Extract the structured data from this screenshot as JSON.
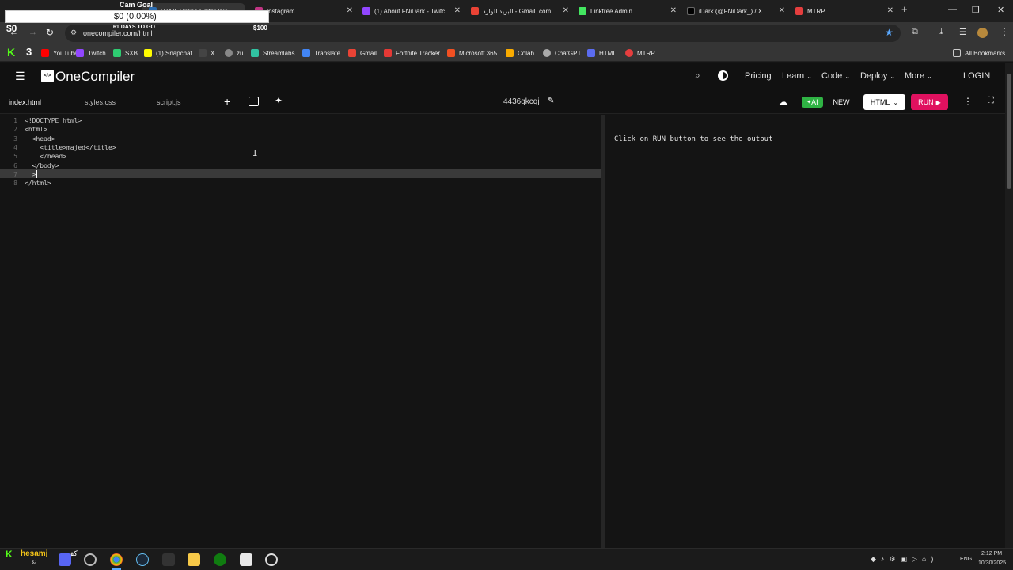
{
  "browser": {
    "tabs": [
      {
        "title": "HTML Online Editor (Co",
        "color": "#2b6cb0",
        "active": true
      },
      {
        "title": "Instagram",
        "color": "#c13584"
      },
      {
        "title": "(1) About FNiDark - Twitc",
        "color": "#9146ff"
      },
      {
        "title": "البريد الوارد - Gmail .com",
        "color": "#ea4335"
      },
      {
        "title": "Linktree Admin",
        "color": "#43e660"
      },
      {
        "title": "iDark (@FNiDark_) / X",
        "color": "#000000"
      },
      {
        "title": "MTRP",
        "color": "#e53e3e"
      }
    ],
    "new_tab": "+",
    "window_controls": {
      "minimize": "—",
      "restore": "❐",
      "close": "✕"
    },
    "url": "onecompiler.com/html",
    "bookmarks": [
      {
        "label": "YouTube",
        "color": "#ff0000"
      },
      {
        "label": "Twitch",
        "color": "#9146ff"
      },
      {
        "label": "SXB",
        "color": "#2ecc71"
      },
      {
        "label": "(1) Snapchat",
        "color": "#fffc00"
      },
      {
        "label": "X",
        "color": "#444444"
      },
      {
        "label": "zu",
        "color": "#888888"
      },
      {
        "label": "Streamlabs",
        "color": "#31c3a2"
      },
      {
        "label": "Translate",
        "color": "#4285f4"
      },
      {
        "label": "Gmail",
        "color": "#ea4335"
      },
      {
        "label": "Fortnite Tracker",
        "color": "#e53935"
      },
      {
        "label": "Microsoft 365",
        "color": "#f25022"
      },
      {
        "label": "Colab",
        "color": "#f9ab00"
      },
      {
        "label": "ChatGPT",
        "color": "#aaaaaa"
      },
      {
        "label": "HTML",
        "color": "#5b6cf0"
      },
      {
        "label": "MTRP",
        "color": "#e53e3e"
      }
    ],
    "all_bookmarks": "All Bookmarks"
  },
  "promo": {
    "title": "Cam Goal",
    "amount": "$0 (0.00%)",
    "current": "$0",
    "days": "61 DAYS TO GO",
    "goal": "$100"
  },
  "app": {
    "logo_text": "OneCompiler",
    "logo_mark": "</>",
    "nav": [
      "Pricing",
      "Learn",
      "Code",
      "Deploy",
      "More"
    ],
    "login": "LOGIN",
    "files": [
      "index.html",
      "styles.css",
      "script.js"
    ],
    "project_id": "4436gkcqj",
    "ai_label": "AI",
    "new_label": "NEW",
    "lang_label": "HTML",
    "run_label": "RUN",
    "output_hint": "Click on RUN button to see the output",
    "accent_run": "#e0115f",
    "accent_ai": "#2fb344"
  },
  "editor": {
    "line_numbers": [
      "1",
      "2",
      "3",
      "4",
      "5",
      "6",
      "7",
      "8"
    ],
    "lines": [
      "<!DOCTYPE html>",
      "<html>",
      "  <head>",
      "    <title>majed</title>",
      "    </head>",
      "  </body>",
      "  >",
      "</html>"
    ]
  },
  "taskbar": {
    "user_label": "hesamj",
    "arabic_text": "كف",
    "lang": "ENG",
    "time": "2:12 PM",
    "date": "10/30/2025"
  }
}
